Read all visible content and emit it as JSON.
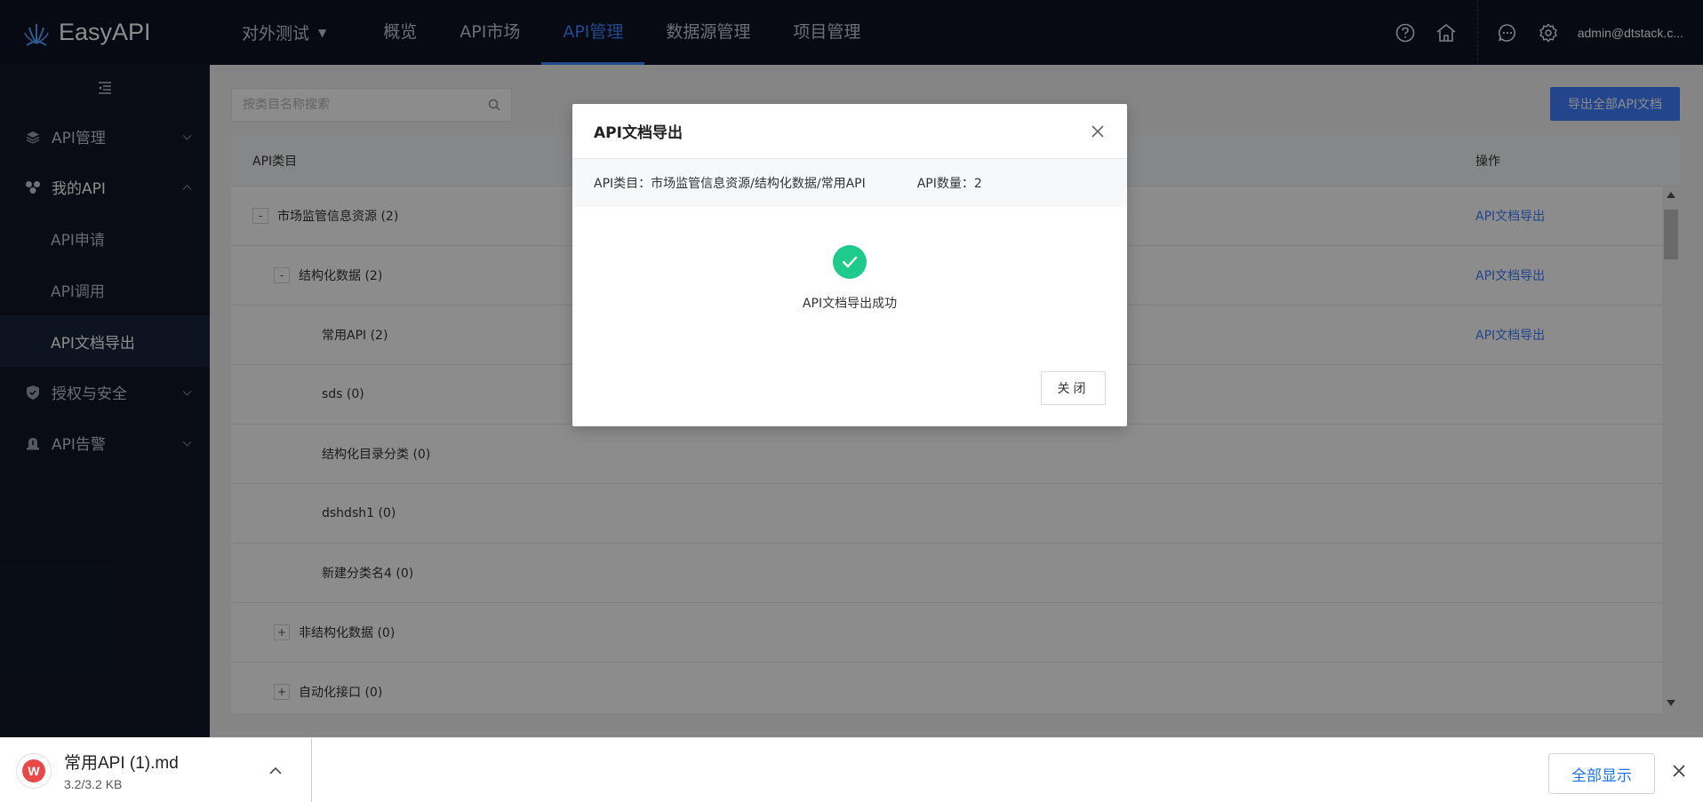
{
  "app": {
    "name": "EasyAPI"
  },
  "header": {
    "project": "对外测试",
    "nav": [
      {
        "label": "概览"
      },
      {
        "label": "API市场"
      },
      {
        "label": "API管理"
      },
      {
        "label": "数据源管理"
      },
      {
        "label": "项目管理"
      }
    ],
    "active_nav": "API管理",
    "icons": [
      "help-icon",
      "home-icon",
      "message-icon",
      "settings-icon"
    ],
    "user": "admin@dtstack.c..."
  },
  "sidebar": {
    "menu": [
      {
        "label": "API管理",
        "icon": "layers-icon",
        "expanded": false
      },
      {
        "label": "我的API",
        "icon": "cluster-icon",
        "expanded": true,
        "children": [
          {
            "label": "API申请"
          },
          {
            "label": "API调用"
          },
          {
            "label": "API文档导出",
            "active": true
          }
        ]
      },
      {
        "label": "授权与安全",
        "icon": "shield-icon",
        "expanded": false
      },
      {
        "label": "API告警",
        "icon": "alarm-icon",
        "expanded": false
      }
    ]
  },
  "content": {
    "search_placeholder": "按类目名称搜索",
    "export_all_label": "导出全部API文档",
    "table": {
      "col_category": "API类目",
      "col_operation": "操作",
      "rows": [
        {
          "toggle": "-",
          "name": "市场监管信息资源 (2)",
          "level": 0,
          "op": "API文档导出"
        },
        {
          "toggle": "-",
          "name": "结构化数据 (2)",
          "level": 1,
          "op": "API文档导出"
        },
        {
          "toggle": "",
          "name": "常用API (2)",
          "level": 2,
          "op": "API文档导出"
        },
        {
          "toggle": "",
          "name": "sds (0)",
          "level": 2,
          "op": ""
        },
        {
          "toggle": "",
          "name": "结构化目录分类 (0)",
          "level": 2,
          "op": ""
        },
        {
          "toggle": "",
          "name": "dshdsh1 (0)",
          "level": 2,
          "op": ""
        },
        {
          "toggle": "",
          "name": "新建分类名4 (0)",
          "level": 2,
          "op": ""
        },
        {
          "toggle": "+",
          "name": "非结构化数据 (0)",
          "level": 1,
          "op": ""
        },
        {
          "toggle": "+",
          "name": "自动化接口 (0)",
          "level": 1,
          "op": ""
        }
      ]
    }
  },
  "modal": {
    "title": "API文档导出",
    "category_label": "API类目：市场监管信息资源/结构化数据/常用API",
    "count_label": "API数量：2",
    "success_message": "API文档导出成功",
    "close_label": "关闭"
  },
  "download_bar": {
    "file_name": "常用API (1).md",
    "file_size": "3.2/3.2 KB",
    "show_all_label": "全部显示"
  },
  "colors": {
    "topbar": "#0d1223",
    "sidebar": "#111727",
    "accent": "#3f7eff",
    "success": "#1fca8d"
  }
}
